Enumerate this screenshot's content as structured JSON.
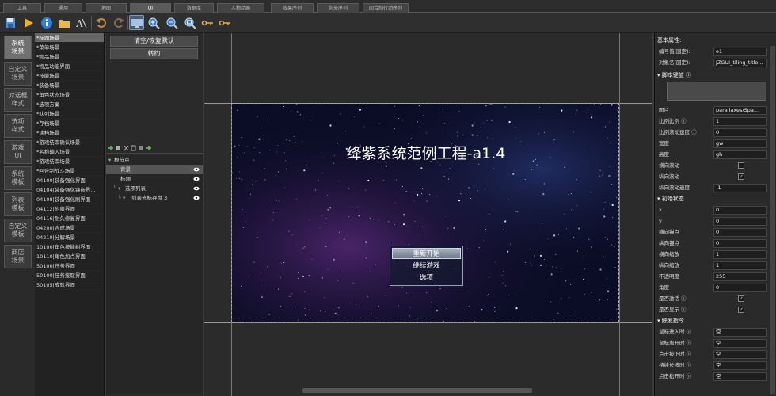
{
  "tabs": [
    "工具",
    "通用",
    "地图",
    "UI",
    "数据库",
    "人物动画",
    "效果序列",
    "你来序列",
    "回合制行动序列"
  ],
  "active_tab_index": 3,
  "toolbar": {
    "icons": [
      "save-icon",
      "play-icon",
      "info-icon",
      "folder-icon",
      "text-tool-icon",
      "undo-icon",
      "redo-icon",
      "screen-icon",
      "zoom-in-icon",
      "zoom-out-icon",
      "zoom-fit-icon",
      "key-icon",
      "key-icon-2"
    ]
  },
  "leftnav": [
    {
      "label": "系统\n场景",
      "active": true
    },
    {
      "label": "自定义\n场景",
      "active": false
    },
    {
      "label": "对话框\n样式",
      "active": false
    },
    {
      "label": "选项\n样式",
      "active": false
    },
    {
      "label": "游戏\nUI",
      "active": false
    },
    {
      "label": "系统\n模板",
      "active": false
    },
    {
      "label": "列表\n模板",
      "active": false
    },
    {
      "label": "自定义\n模板",
      "active": false
    },
    {
      "label": "商店\n场景",
      "active": false
    }
  ],
  "scenes": [
    "*标题场景",
    "*菜单场景",
    "*物品场景",
    "*物品功能界面",
    "*技能场景",
    "*装备场景",
    "*角色状态场景",
    "*选项方案",
    "*队列场景",
    "*存档场景",
    "*读档场景",
    "*游戏结束确认场景",
    "*名称输入场景",
    "*游戏结束场景",
    "*回合制战斗场景",
    "04100|装备强化界面",
    "04104|装备强化镶嵌界...",
    "04108|装备强化刷界面",
    "04112|附魔界面",
    "04116|耐久修复界面",
    "04200|合成场景",
    "04210|分解场景",
    "10100|角色技能树界面",
    "10110|角色加点界面",
    "50100|任务界面",
    "50100|任务接取界面",
    "50105|成就界面"
  ],
  "selected_scene_index": 0,
  "mid": {
    "btn_reset": "清空/恢复默认",
    "btn_save": "转约"
  },
  "tree": [
    {
      "label": "根节点",
      "indent": 0,
      "expand": "▾",
      "eye": false,
      "sel": false
    },
    {
      "label": "背景",
      "indent": 1,
      "expand": "",
      "eye": true,
      "sel": true
    },
    {
      "label": "标题",
      "indent": 1,
      "expand": "",
      "eye": true,
      "sel": false
    },
    {
      "label": "选项列表",
      "indent": 1,
      "expand": "└ ▾",
      "eye": true,
      "sel": false
    },
    {
      "label": "列表光标存盘 3",
      "indent": 2,
      "expand": "└ ▾",
      "eye": true,
      "sel": false
    }
  ],
  "game": {
    "title": "绛紫系统范例工程-a1.4",
    "menu": [
      "重新开始",
      "继续游戏",
      "选项"
    ],
    "menu_selected": 0
  },
  "props": {
    "header": "基本属性:",
    "rows1": [
      {
        "label": "编号值(固定):",
        "value": "e1"
      },
      {
        "label": "对象名(固定):",
        "value": "JZGUI_tiling_title..."
      }
    ],
    "sect_script": "脚本键值 ⓘ",
    "rows2": [
      {
        "label": "图片",
        "value": "parallaxes/Spa..."
      },
      {
        "label": "比例比例 ⓘ",
        "value": "1"
      },
      {
        "label": "比例滚动速度 ⓘ",
        "value": "0"
      },
      {
        "label": "宽度",
        "value": "gw"
      },
      {
        "label": "高度",
        "value": "gh"
      }
    ],
    "checks1": [
      {
        "label": "横向滚动",
        "checked": false
      },
      {
        "label": "纵向滚动",
        "checked": true
      }
    ],
    "row_speed": {
      "label": "纵向滚动速度",
      "value": "-1"
    },
    "sect_init": "初始状态",
    "rows3": [
      {
        "label": "x",
        "value": "0"
      },
      {
        "label": "y",
        "value": "0"
      },
      {
        "label": "横向锚点",
        "value": "0"
      },
      {
        "label": "纵向锚点",
        "value": "0"
      },
      {
        "label": "横向缩放",
        "value": "1"
      },
      {
        "label": "纵向缩放",
        "value": "1"
      },
      {
        "label": "不透明度",
        "value": "255"
      },
      {
        "label": "角度",
        "value": "0"
      }
    ],
    "checks2": [
      {
        "label": "是否激活 ⓘ",
        "checked": true
      },
      {
        "label": "是否显示 ⓘ",
        "checked": true
      }
    ],
    "sect_trigger": "触发指令",
    "rows4": [
      {
        "label": "鼠标进入时 ⓘ",
        "value": "空"
      },
      {
        "label": "鼠标离开时 ⓘ",
        "value": "空"
      },
      {
        "label": "点击按下时 ⓘ",
        "value": "空"
      },
      {
        "label": "持续长按时 ⓘ",
        "value": "空"
      },
      {
        "label": "点击松开时 ⓘ",
        "value": "空"
      }
    ]
  }
}
